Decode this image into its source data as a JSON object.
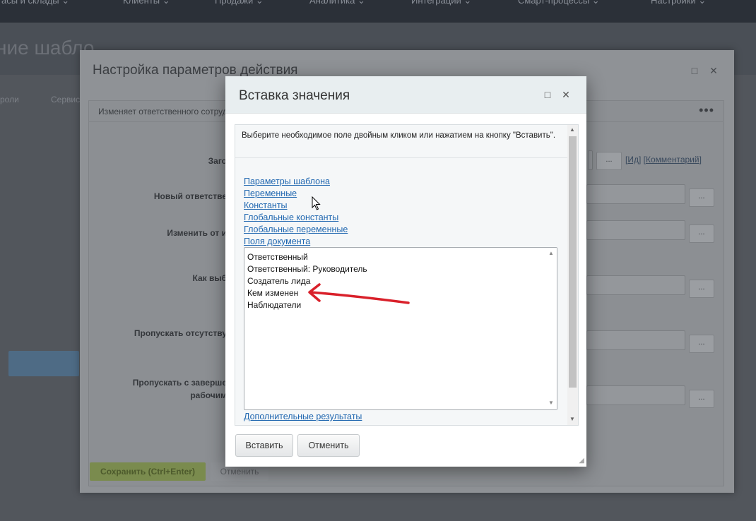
{
  "background_app": {
    "nav_items": [
      "асы и склады ⌄",
      "Клиенты ⌄",
      "Продажи ⌄",
      "Аналитика ⌄",
      "Интеграции ⌄",
      "Смарт-процессы ⌄",
      "Настройки ⌄"
    ],
    "page_title": "ние шабло",
    "breadcrumbs": [
      "роли",
      "Сервис"
    ]
  },
  "parent_dialog": {
    "title": "Настройка параметров действия",
    "description": "Изменяет ответственного сотруд",
    "labels": [
      "Заго",
      "Новый ответстве",
      "Изменить от и",
      "Как выб",
      "Пропускать отсутству",
      "Пропускать с заверше",
      "рабочим"
    ],
    "links": [
      "Ид",
      "Комментарий"
    ],
    "dots_label": "...",
    "save_label": "Сохранить (Ctrl+Enter)",
    "cancel_label": "Отменить"
  },
  "modal": {
    "title": "Вставка значения",
    "maximize_icon": "□",
    "close_icon": "✕",
    "hint": "Выберите необходимое поле двойным кликом или нажатием на кнопку \"Вставить\".",
    "links": {
      "template_params": "Параметры шаблона",
      "variables": "Переменные",
      "constants": "Константы",
      "global_constants": "Глобальные константы",
      "global_variables": "Глобальные переменные",
      "document_fields": "Поля документа"
    },
    "options": [
      "Ответственный",
      "Ответственный: Руководитель",
      "Создатель лида",
      "Кем изменен",
      "Наблюдатели"
    ],
    "extra_link": "Дополнительные результаты",
    "insert_label": "Вставить",
    "cancel_label": "Отменить"
  },
  "colors": {
    "link": "#2067b0",
    "annotation_arrow": "#d9202a",
    "save_green": "#7a8b4e"
  }
}
